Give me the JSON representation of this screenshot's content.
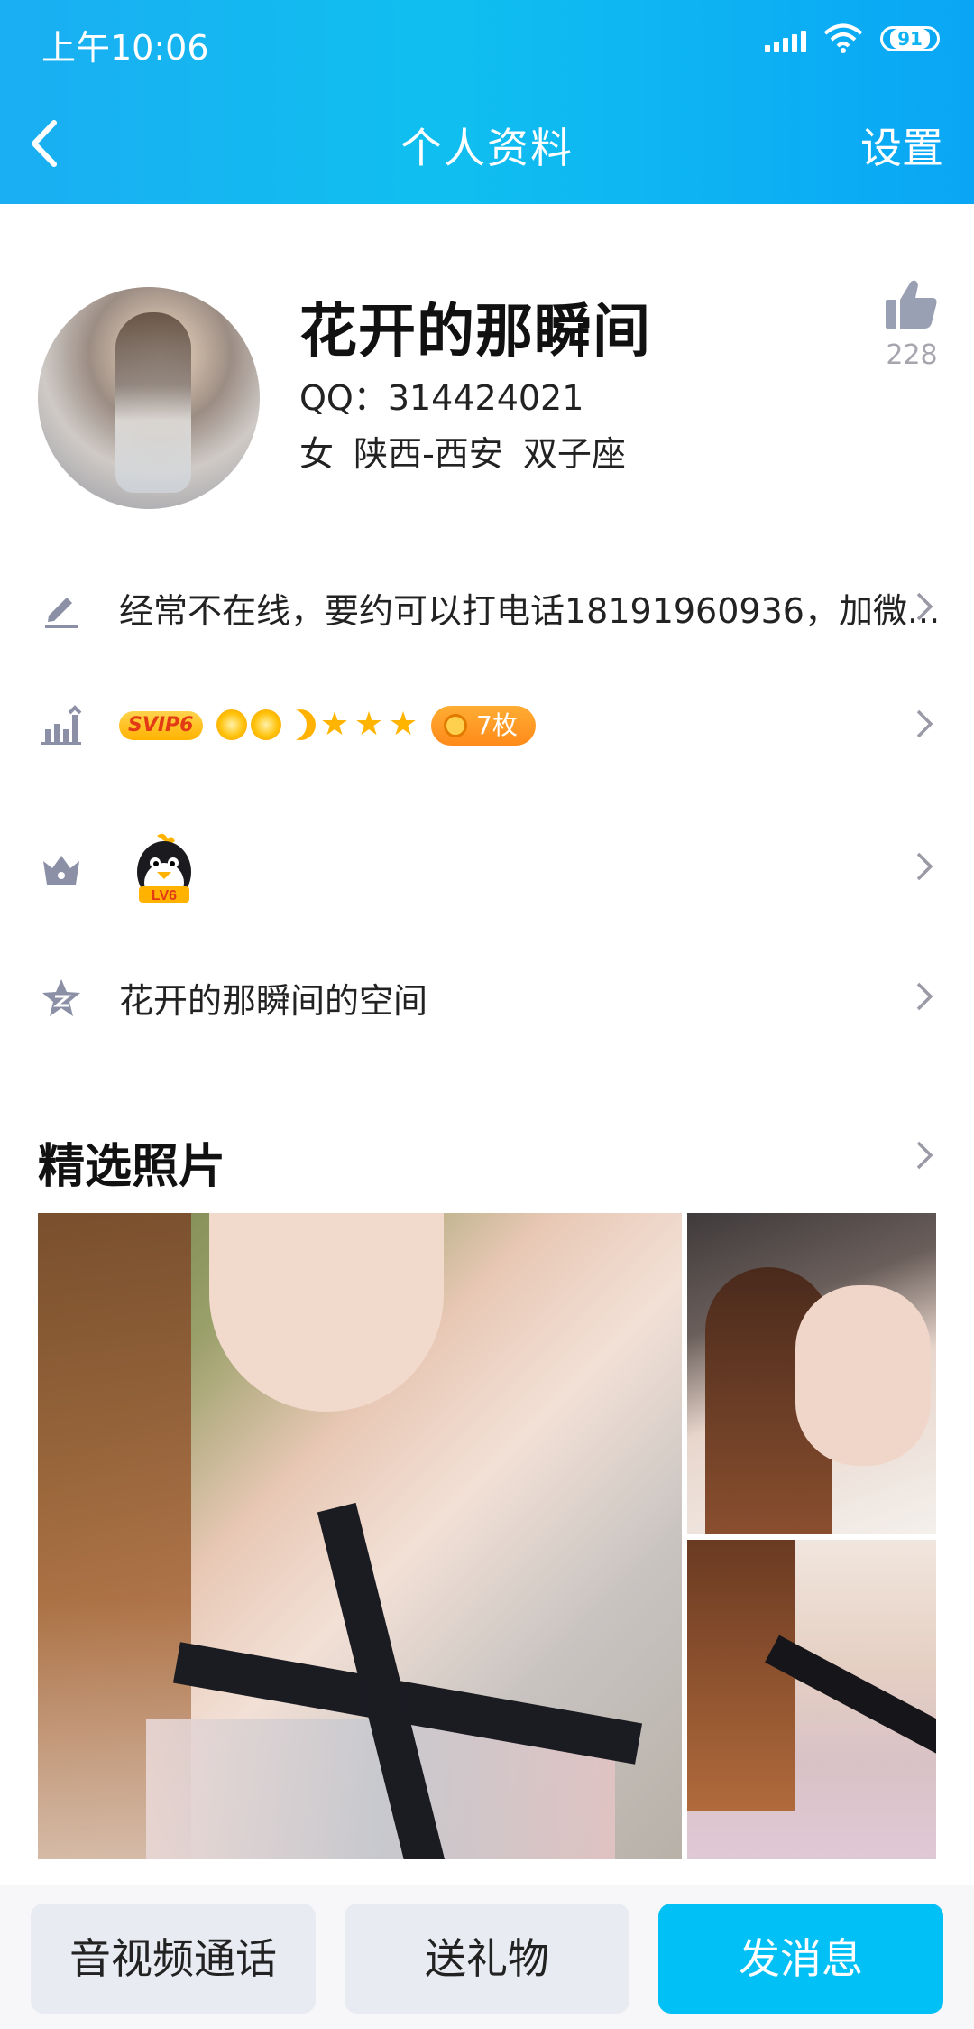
{
  "status_bar": {
    "time": "上午10:06",
    "battery": "91"
  },
  "nav": {
    "title": "个人资料",
    "settings_label": "设置"
  },
  "profile": {
    "nickname": "花开的那瞬间",
    "qq_line": "QQ：314424021",
    "info_line": "女  陕西-西安  双子座",
    "like_count": "228"
  },
  "rows": {
    "signature": "经常不在线，要约可以打电话18191960936，加微...",
    "svip_badge": "SVIP6",
    "coin_label": "7枚",
    "qzone_label": "花开的那瞬间的空间"
  },
  "qq_level": {
    "badge": "LV6"
  },
  "photos": {
    "section_title": "精选照片"
  },
  "bottom_buttons": {
    "call": "音视频通话",
    "gift": "送礼物",
    "message": "发消息"
  },
  "colors": {
    "header_accent": "#10bff0",
    "primary_button": "#00c0f6"
  },
  "icons": [
    "back-icon",
    "signal-icon",
    "wifi-icon",
    "battery-icon",
    "thumbs-up-icon",
    "edit-icon",
    "level-chart-icon",
    "crown-icon",
    "qzone-star-icon",
    "chevron-right-icon"
  ]
}
